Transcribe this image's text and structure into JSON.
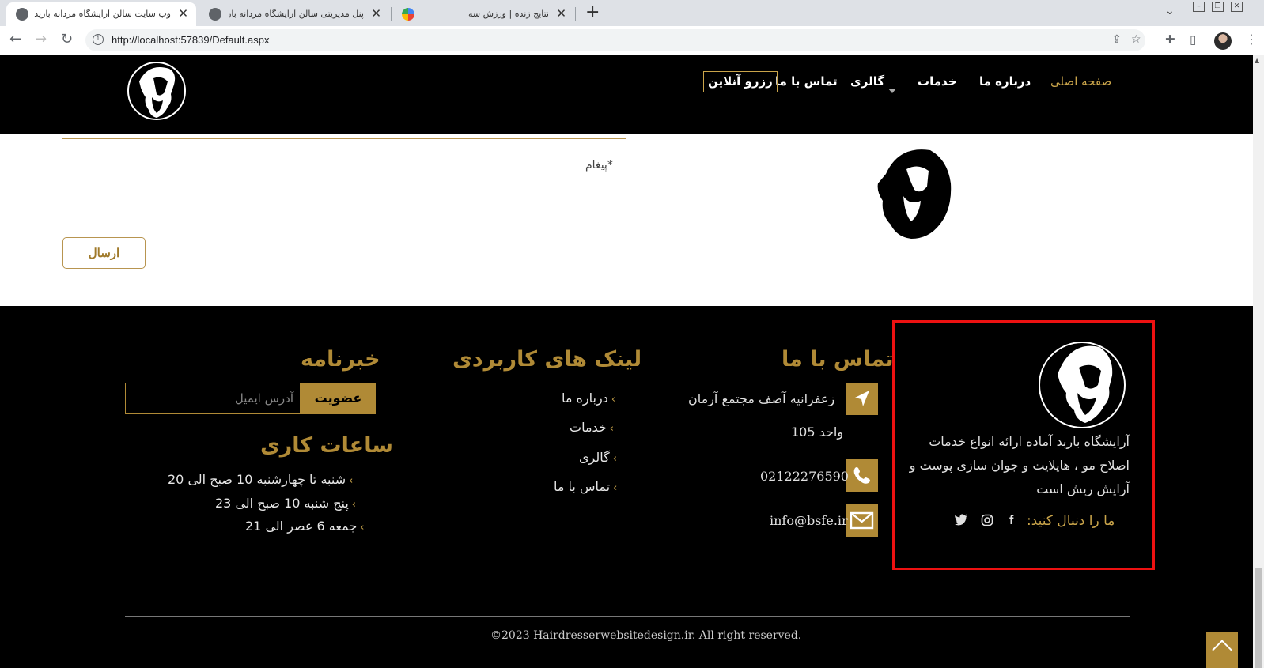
{
  "browser": {
    "tabs": [
      {
        "title": "وب سایت سالن آرایشگاه مردانه بارید",
        "active": true
      },
      {
        "title": "پنل مدیریتی سالن آرایشگاه مردانه بار",
        "active": false
      },
      {
        "title": "نتایج زنده | ورزش سه",
        "active": false
      }
    ],
    "url": "http://localhost:57839/Default.aspx",
    "new_tab": "+",
    "close": "✕"
  },
  "nav": {
    "items": [
      "صفحه اصلی",
      "درباره ما",
      "خدمات",
      "گالری",
      "تماس با ما"
    ],
    "reserve": "رزرو آنلاین",
    "active_color": "#c9a44a"
  },
  "form": {
    "message_label": "پیغام*",
    "send_label": "ارسال"
  },
  "footer": {
    "about": {
      "text": "آرایشگاه باربد آماده ارائه انواع خدمات اصلاح مو ، هایلایت و جوان سازی پوست و آرایش ریش است",
      "follow_label": "ما را دنبال کنید:",
      "socials": [
        "facebook-icon",
        "instagram-icon",
        "twitter-icon"
      ]
    },
    "contact": {
      "title": "تماس با ما",
      "address_line1": "زعفرانیه آصف مجتمع آرمان",
      "address_line2": "واحد 105",
      "phone": "02122276590",
      "email": "info@bsfe.ir"
    },
    "links": {
      "title": "لینک های کاربردی",
      "items": [
        "درباره ما",
        "خدمات",
        "گالری",
        "تماس با ما"
      ]
    },
    "newsletter": {
      "title": "خبرنامه",
      "placeholder": "آدرس ایمیل",
      "button": "عضویت"
    },
    "hours": {
      "title": "ساعات کاری",
      "items": [
        "شنبه تا چهارشنبه 10 صبح الی 20",
        "پنج شنبه 10 صبح الی 23",
        "جمعه 6 عصر الی 21"
      ]
    },
    "copyright": "©2023 Hairdresserwebsitedesign.ir. All right reserved.",
    "accent_color": "#b08a36"
  }
}
